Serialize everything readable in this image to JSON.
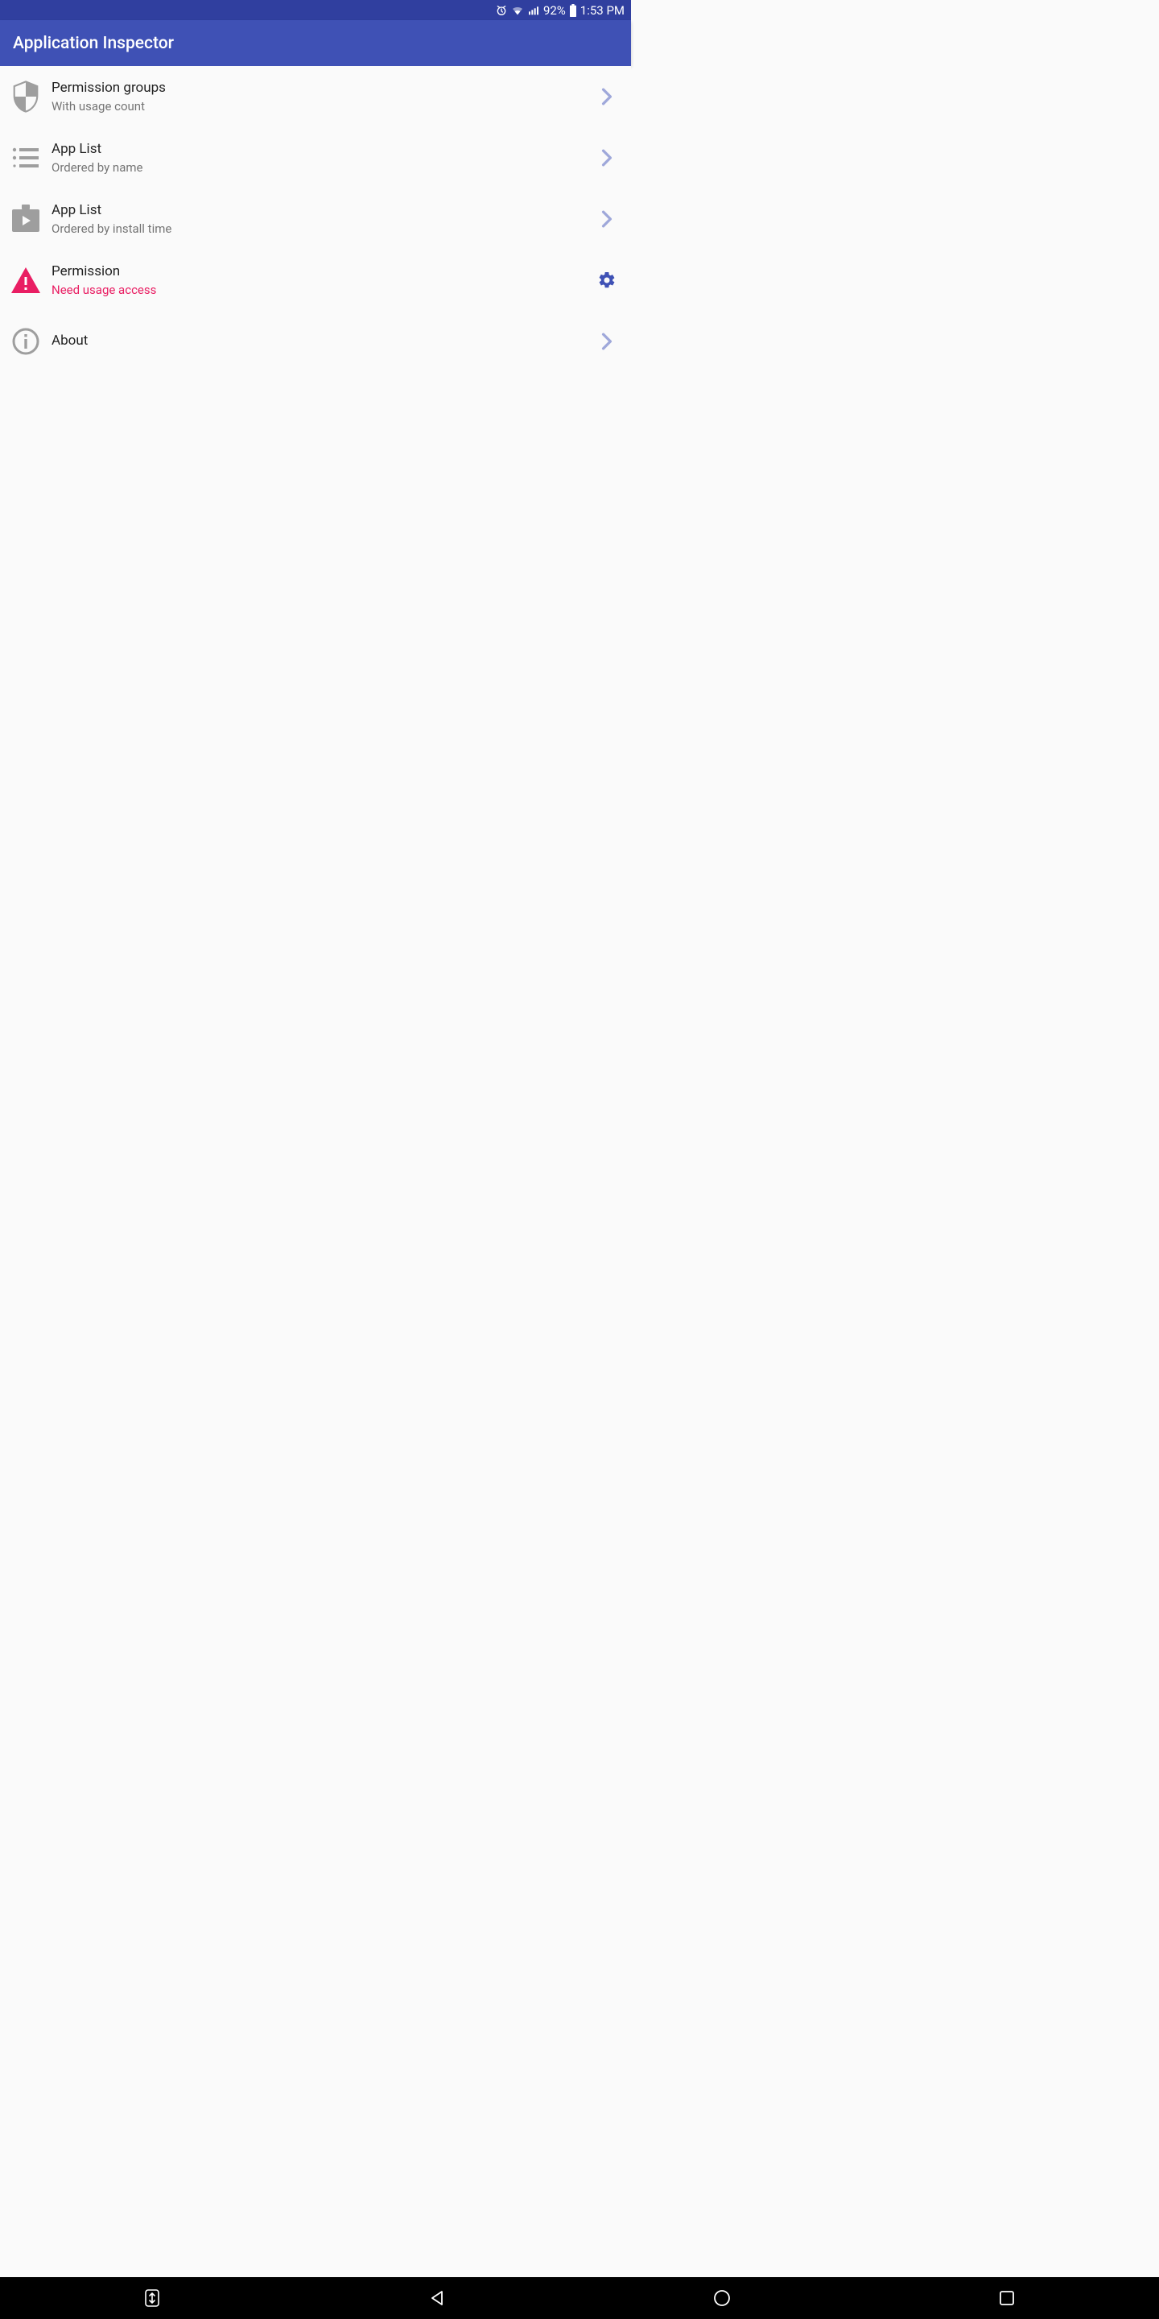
{
  "status": {
    "battery_percent": "92%",
    "time": "1:53 PM"
  },
  "appbar": {
    "title": "Application Inspector"
  },
  "items": [
    {
      "title": "Permission groups",
      "subtitle": "With usage count"
    },
    {
      "title": "App List",
      "subtitle": "Ordered by name"
    },
    {
      "title": "App List",
      "subtitle": "Ordered by install time"
    },
    {
      "title": "Permission",
      "subtitle": "Need usage access"
    },
    {
      "title": "About",
      "subtitle": ""
    }
  ],
  "colors": {
    "primary": "#3f51b5",
    "primary_dark": "#303f9f",
    "accent_arrow": "#9fa8da",
    "gear": "#3f51b5",
    "warn": "#e91e63",
    "icon_grey": "#9e9e9e"
  }
}
